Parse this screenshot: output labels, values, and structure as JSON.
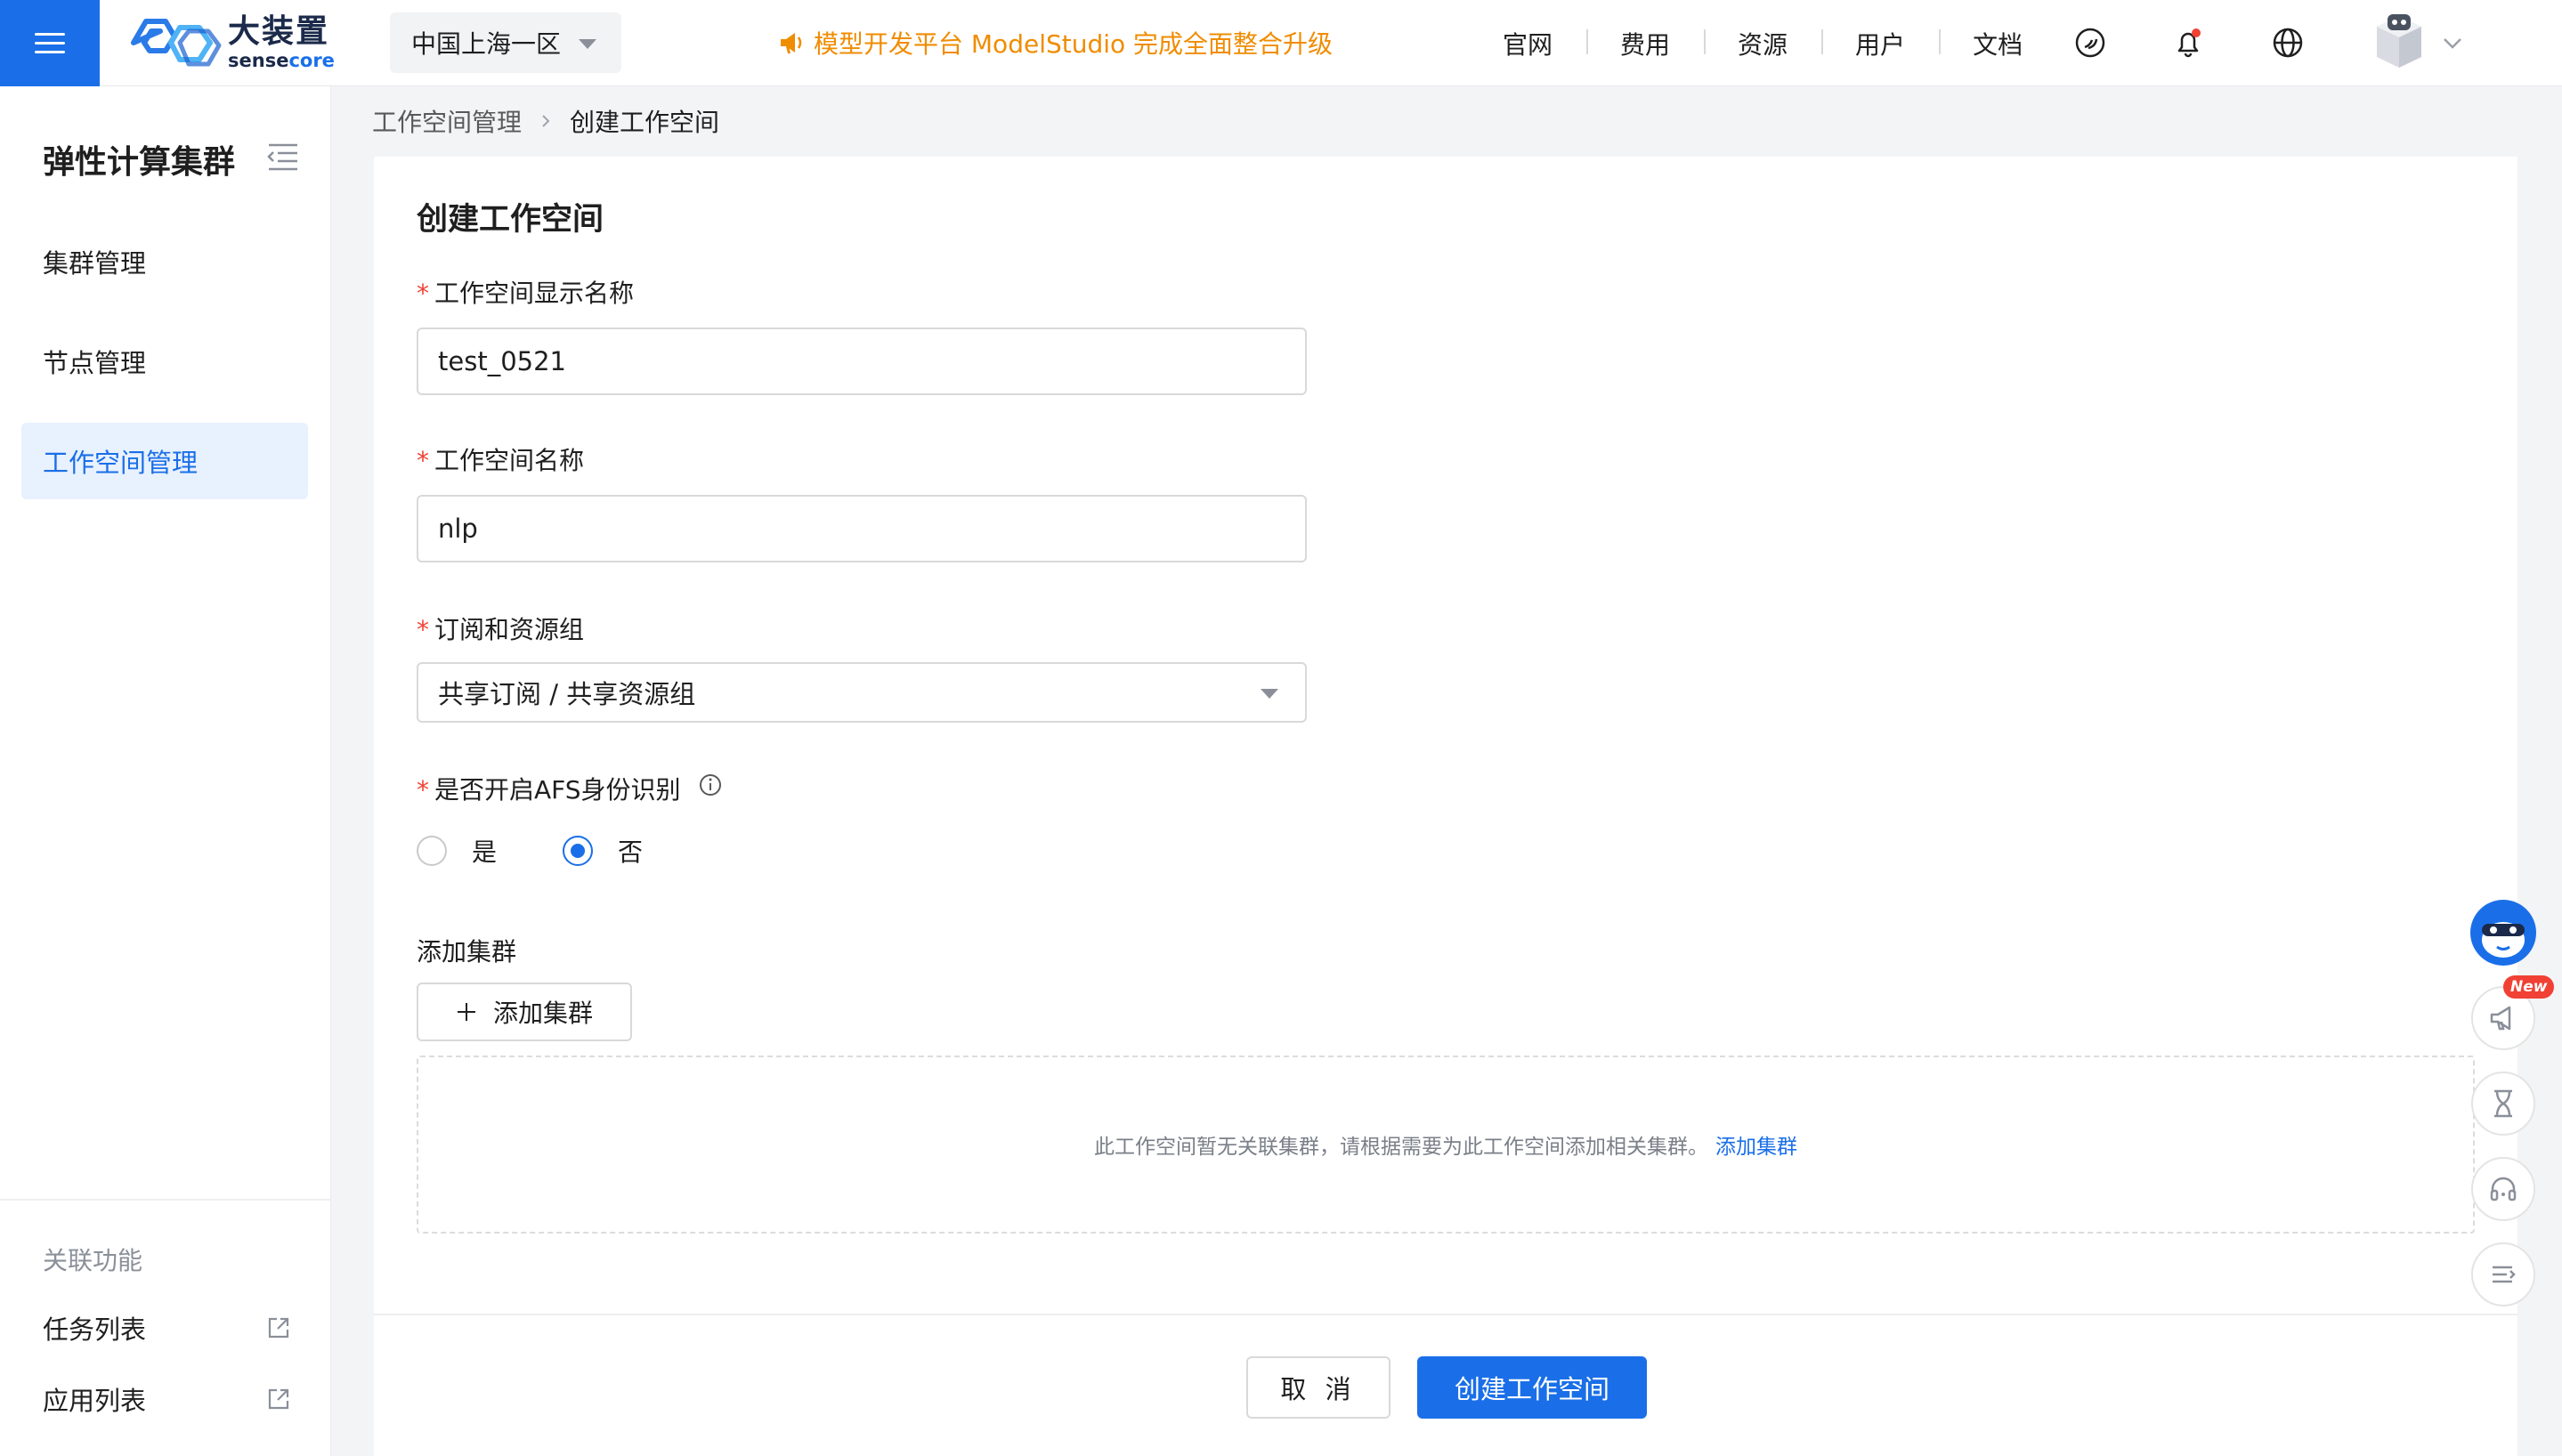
{
  "topbar": {
    "logo_cn": "大装置",
    "logo_en_prefix": "sense",
    "logo_en_suffix": "core",
    "region": "中国上海一区",
    "announcement": "模型开发平台 ModelStudio 完成全面整合升级",
    "nav": [
      "官网",
      "费用",
      "资源",
      "用户",
      "文档"
    ],
    "icons": [
      "sensecore-link-icon",
      "bell-icon",
      "globe-icon"
    ]
  },
  "sidebar": {
    "title": "弹性计算集群",
    "items": [
      {
        "label": "集群管理",
        "active": false
      },
      {
        "label": "节点管理",
        "active": false
      },
      {
        "label": "工作空间管理",
        "active": true
      }
    ],
    "related_title": "关联功能",
    "related_links": [
      {
        "label": "任务列表"
      },
      {
        "label": "应用列表"
      }
    ]
  },
  "breadcrumb": {
    "parent": "工作空间管理",
    "current": "创建工作空间"
  },
  "form": {
    "title": "创建工作空间",
    "display_name": {
      "label": "工作空间显示名称",
      "value": "test_0521"
    },
    "name": {
      "label": "工作空间名称",
      "value": "nlp"
    },
    "subscription": {
      "label": "订阅和资源组",
      "value": "共享订阅 / 共享资源组"
    },
    "afs": {
      "label": "是否开启AFS身份识别",
      "options": [
        "是",
        "否"
      ],
      "selected": "否"
    },
    "clusters": {
      "label": "添加集群",
      "add_button": "添加集群",
      "empty_text": "此工作空间暂无关联集群，请根据需要为此工作空间添加相关集群。",
      "empty_link": "添加集群"
    }
  },
  "footer": {
    "cancel": "取 消",
    "submit": "创建工作空间"
  },
  "float_tools": {
    "badge": "New",
    "icons": [
      "assistant-bot-icon",
      "megaphone-icon",
      "hourglass-icon",
      "headset-icon",
      "collapse-panel-icon"
    ]
  },
  "colors": {
    "primary": "#1a6fe8",
    "announcement": "#f08c00",
    "required": "#f04134",
    "active_bg": "#e8f1fe"
  }
}
